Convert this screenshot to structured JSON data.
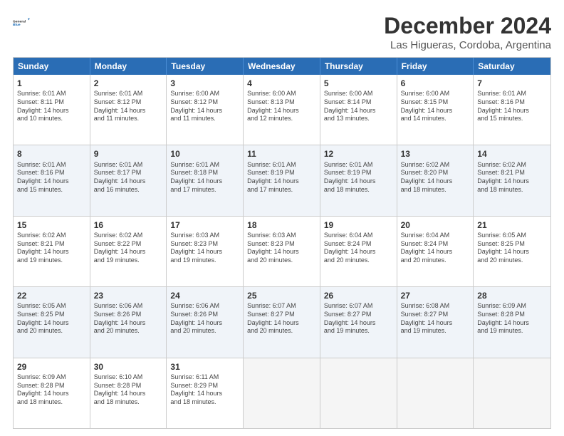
{
  "logo": {
    "line1": "General",
    "line2": "Blue"
  },
  "title": "December 2024",
  "location": "Las Higueras, Cordoba, Argentina",
  "days_of_week": [
    "Sunday",
    "Monday",
    "Tuesday",
    "Wednesday",
    "Thursday",
    "Friday",
    "Saturday"
  ],
  "weeks": [
    [
      {
        "day": "1",
        "info": "Sunrise: 6:01 AM\nSunset: 8:11 PM\nDaylight: 14 hours\nand 10 minutes."
      },
      {
        "day": "2",
        "info": "Sunrise: 6:01 AM\nSunset: 8:12 PM\nDaylight: 14 hours\nand 11 minutes."
      },
      {
        "day": "3",
        "info": "Sunrise: 6:00 AM\nSunset: 8:12 PM\nDaylight: 14 hours\nand 11 minutes."
      },
      {
        "day": "4",
        "info": "Sunrise: 6:00 AM\nSunset: 8:13 PM\nDaylight: 14 hours\nand 12 minutes."
      },
      {
        "day": "5",
        "info": "Sunrise: 6:00 AM\nSunset: 8:14 PM\nDaylight: 14 hours\nand 13 minutes."
      },
      {
        "day": "6",
        "info": "Sunrise: 6:00 AM\nSunset: 8:15 PM\nDaylight: 14 hours\nand 14 minutes."
      },
      {
        "day": "7",
        "info": "Sunrise: 6:01 AM\nSunset: 8:16 PM\nDaylight: 14 hours\nand 15 minutes."
      }
    ],
    [
      {
        "day": "8",
        "info": "Sunrise: 6:01 AM\nSunset: 8:16 PM\nDaylight: 14 hours\nand 15 minutes."
      },
      {
        "day": "9",
        "info": "Sunrise: 6:01 AM\nSunset: 8:17 PM\nDaylight: 14 hours\nand 16 minutes."
      },
      {
        "day": "10",
        "info": "Sunrise: 6:01 AM\nSunset: 8:18 PM\nDaylight: 14 hours\nand 17 minutes."
      },
      {
        "day": "11",
        "info": "Sunrise: 6:01 AM\nSunset: 8:19 PM\nDaylight: 14 hours\nand 17 minutes."
      },
      {
        "day": "12",
        "info": "Sunrise: 6:01 AM\nSunset: 8:19 PM\nDaylight: 14 hours\nand 18 minutes."
      },
      {
        "day": "13",
        "info": "Sunrise: 6:02 AM\nSunset: 8:20 PM\nDaylight: 14 hours\nand 18 minutes."
      },
      {
        "day": "14",
        "info": "Sunrise: 6:02 AM\nSunset: 8:21 PM\nDaylight: 14 hours\nand 18 minutes."
      }
    ],
    [
      {
        "day": "15",
        "info": "Sunrise: 6:02 AM\nSunset: 8:21 PM\nDaylight: 14 hours\nand 19 minutes."
      },
      {
        "day": "16",
        "info": "Sunrise: 6:02 AM\nSunset: 8:22 PM\nDaylight: 14 hours\nand 19 minutes."
      },
      {
        "day": "17",
        "info": "Sunrise: 6:03 AM\nSunset: 8:23 PM\nDaylight: 14 hours\nand 19 minutes."
      },
      {
        "day": "18",
        "info": "Sunrise: 6:03 AM\nSunset: 8:23 PM\nDaylight: 14 hours\nand 20 minutes."
      },
      {
        "day": "19",
        "info": "Sunrise: 6:04 AM\nSunset: 8:24 PM\nDaylight: 14 hours\nand 20 minutes."
      },
      {
        "day": "20",
        "info": "Sunrise: 6:04 AM\nSunset: 8:24 PM\nDaylight: 14 hours\nand 20 minutes."
      },
      {
        "day": "21",
        "info": "Sunrise: 6:05 AM\nSunset: 8:25 PM\nDaylight: 14 hours\nand 20 minutes."
      }
    ],
    [
      {
        "day": "22",
        "info": "Sunrise: 6:05 AM\nSunset: 8:25 PM\nDaylight: 14 hours\nand 20 minutes."
      },
      {
        "day": "23",
        "info": "Sunrise: 6:06 AM\nSunset: 8:26 PM\nDaylight: 14 hours\nand 20 minutes."
      },
      {
        "day": "24",
        "info": "Sunrise: 6:06 AM\nSunset: 8:26 PM\nDaylight: 14 hours\nand 20 minutes."
      },
      {
        "day": "25",
        "info": "Sunrise: 6:07 AM\nSunset: 8:27 PM\nDaylight: 14 hours\nand 20 minutes."
      },
      {
        "day": "26",
        "info": "Sunrise: 6:07 AM\nSunset: 8:27 PM\nDaylight: 14 hours\nand 19 minutes."
      },
      {
        "day": "27",
        "info": "Sunrise: 6:08 AM\nSunset: 8:27 PM\nDaylight: 14 hours\nand 19 minutes."
      },
      {
        "day": "28",
        "info": "Sunrise: 6:09 AM\nSunset: 8:28 PM\nDaylight: 14 hours\nand 19 minutes."
      }
    ],
    [
      {
        "day": "29",
        "info": "Sunrise: 6:09 AM\nSunset: 8:28 PM\nDaylight: 14 hours\nand 18 minutes."
      },
      {
        "day": "30",
        "info": "Sunrise: 6:10 AM\nSunset: 8:28 PM\nDaylight: 14 hours\nand 18 minutes."
      },
      {
        "day": "31",
        "info": "Sunrise: 6:11 AM\nSunset: 8:29 PM\nDaylight: 14 hours\nand 18 minutes."
      },
      {
        "day": "",
        "info": ""
      },
      {
        "day": "",
        "info": ""
      },
      {
        "day": "",
        "info": ""
      },
      {
        "day": "",
        "info": ""
      }
    ]
  ],
  "alt_rows": [
    1,
    3
  ]
}
